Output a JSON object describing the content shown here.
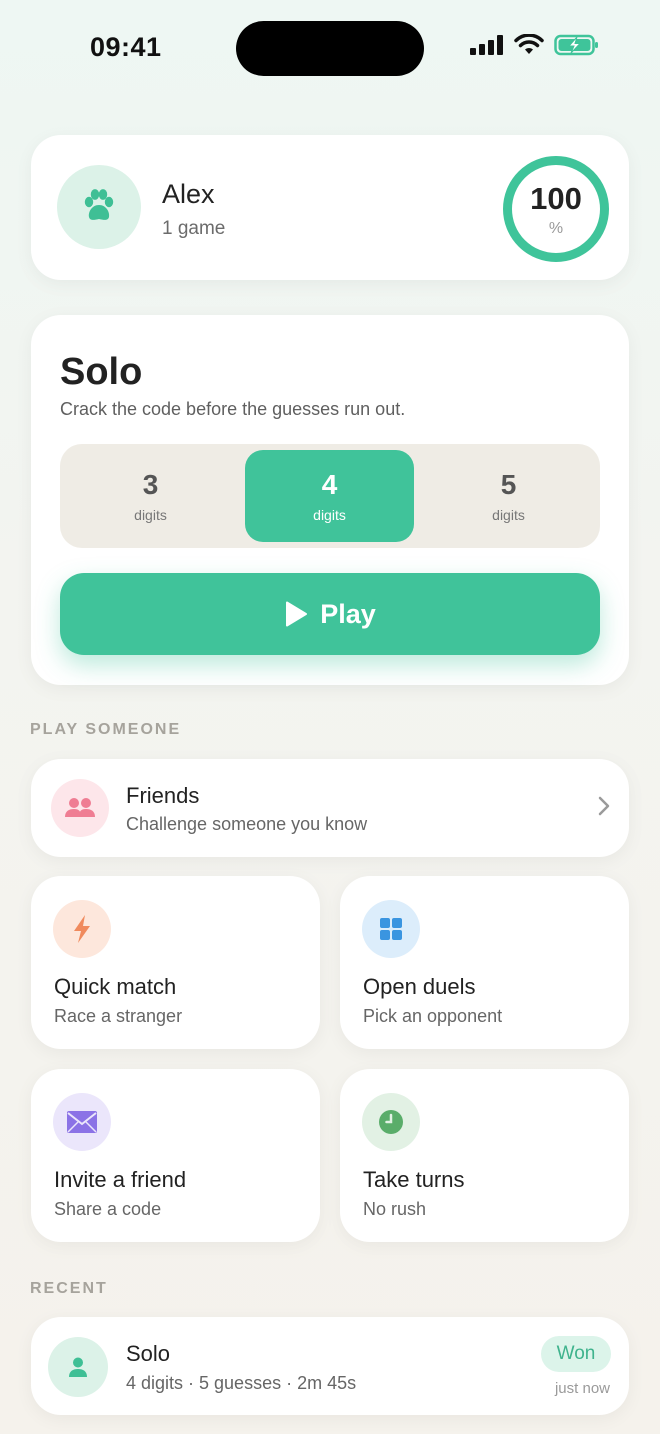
{
  "status_bar": {
    "time": "09:41"
  },
  "profile": {
    "name": "Alex",
    "games": "1 game",
    "win_rate": "100",
    "win_rate_unit": "%"
  },
  "solo": {
    "title": "Solo",
    "description": "Crack the code before the guesses run out.",
    "options": [
      {
        "value": "3",
        "label": "digits"
      },
      {
        "value": "4",
        "label": "digits"
      },
      {
        "value": "5",
        "label": "digits"
      }
    ],
    "selected": "4",
    "play_label": "Play"
  },
  "play_someone": {
    "heading": "PLAY SOMEONE",
    "friends": {
      "title": "Friends",
      "subtitle": "Challenge someone you know"
    },
    "tiles": [
      {
        "title": "Quick match",
        "subtitle": "Race a stranger",
        "icon": "lightning-icon"
      },
      {
        "title": "Open duels",
        "subtitle": "Pick an opponent",
        "icon": "grid-icon"
      },
      {
        "title": "Invite a friend",
        "subtitle": "Share a code",
        "icon": "envelope-icon"
      },
      {
        "title": "Take turns",
        "subtitle": "No rush",
        "icon": "clock-icon"
      }
    ]
  },
  "recent": {
    "heading": "RECENT",
    "items": [
      {
        "title": "Solo",
        "details": "4 digits · 5 guesses · 2m 45s",
        "result": "Won",
        "when": "just now"
      }
    ]
  },
  "colors": {
    "accent": "#40c39a",
    "background": "#f4f3ee"
  }
}
